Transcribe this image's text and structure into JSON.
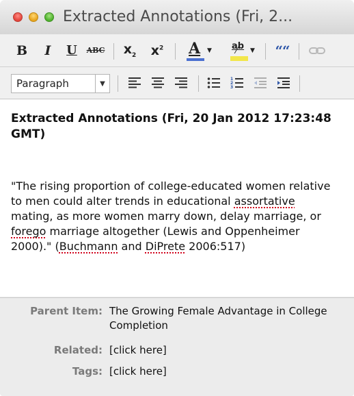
{
  "window": {
    "title": "Extracted Annotations (Fri, 2..."
  },
  "toolbar": {
    "bold": "B",
    "italic": "I",
    "underline": "U",
    "strikethrough": "ABC",
    "subscript": "x",
    "subscript_mark": "2",
    "superscript": "x",
    "superscript_mark": "2",
    "text_color": "A",
    "highlight": "ab",
    "blockquote": "““",
    "format_select": "Paragraph",
    "text_color_hex": "#4a6fd0",
    "highlight_hex": "#f2e64a"
  },
  "note": {
    "heading": "Extracted Annotations (Fri, 20 Jan 2012 17:23:48 GMT)",
    "body_parts": [
      "\"The rising proportion of college-educated women relative to men could alter trends in educational ",
      "assortative",
      " mating, as more women marry down, delay marriage, or ",
      "forego",
      " marriage altogether (Lewis and Oppenheimer 2000).\" (",
      "Buchmann",
      " and ",
      "DiPrete",
      " 2006:517)"
    ]
  },
  "meta": {
    "parent_label": "Parent Item:",
    "parent_value": "The Growing Female Advantage in College Completion",
    "related_label": "Related:",
    "related_value": "[click here]",
    "tags_label": "Tags:",
    "tags_value": "[click here]"
  }
}
